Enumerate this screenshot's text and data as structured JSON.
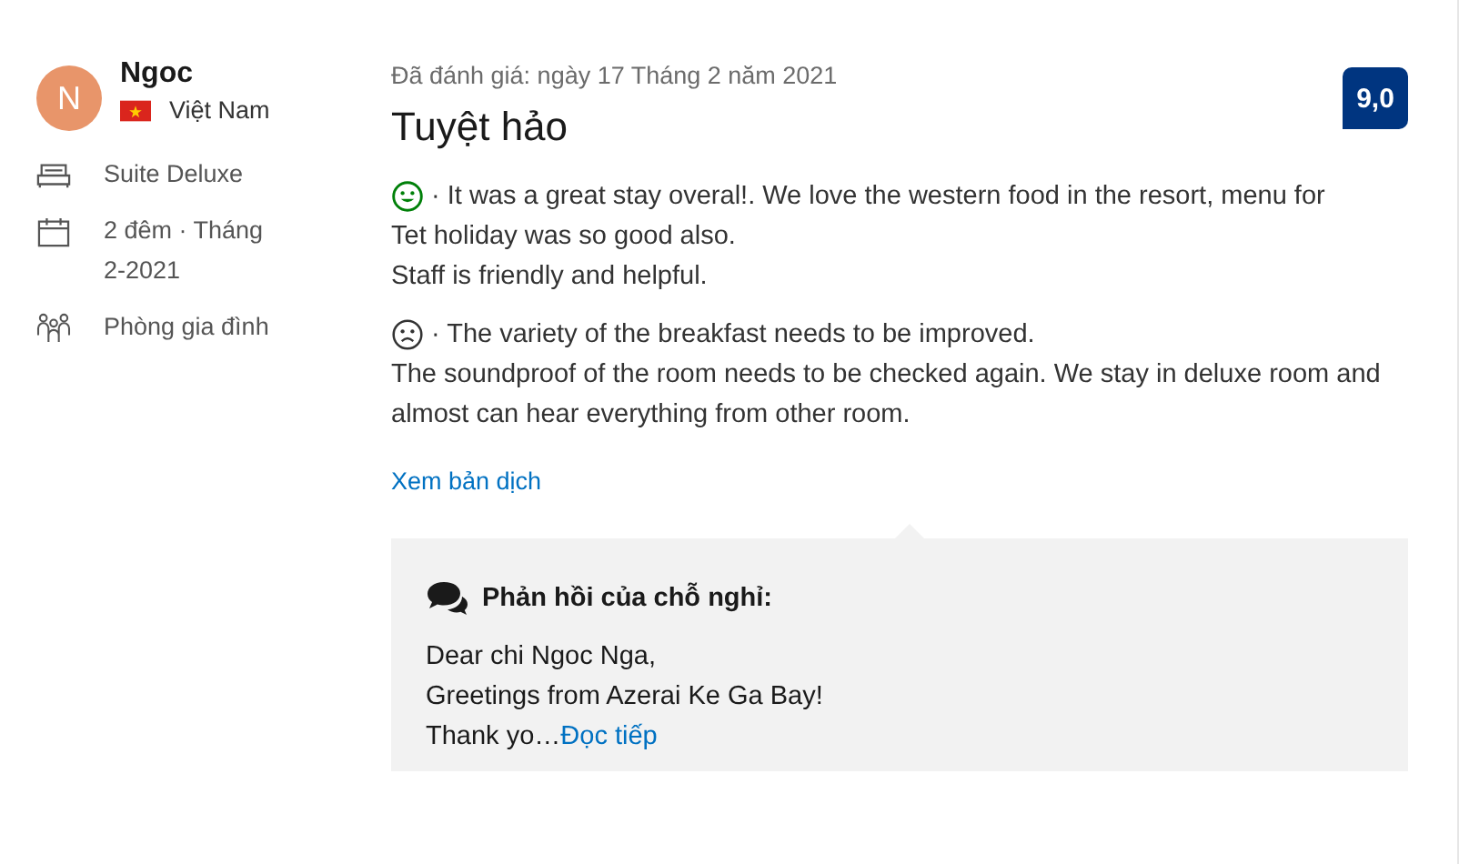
{
  "reviewer": {
    "initial": "N",
    "name": "Ngoc",
    "country": "Việt Nam"
  },
  "stay_details": [
    {
      "kind": "room",
      "text": "Suite Deluxe"
    },
    {
      "kind": "dates",
      "text": "2 đêm · Tháng 2-2021"
    },
    {
      "kind": "group",
      "text": "Phòng gia đình"
    }
  ],
  "review": {
    "date": "Đã đánh giá: ngày 17 Tháng 2 năm 2021",
    "title": "Tuyệt hảo",
    "score": "9,0",
    "paragraphs": [
      {
        "kind": "positive",
        "lines": [
          "· It was a great stay overal!. We love the western food in the resort, menu for",
          "Tet holiday was so good also.",
          "Staff is friendly and helpful."
        ]
      },
      {
        "kind": "negative",
        "lines": [
          "· The variety of the breakfast needs to be improved.",
          "The soundproof of the room needs to be checked again. We stay in deluxe room and almost can hear everything from other room."
        ]
      }
    ],
    "translate_link": "Xem bản dịch"
  },
  "property_reply": {
    "heading": "Phản hồi của chỗ nghỉ:",
    "lines": [
      "Dear chi Ngoc Nga,",
      "Greetings from Azerai Ke Ga Bay!",
      "Thank yo…"
    ],
    "more_link": "Đọc tiếp"
  }
}
